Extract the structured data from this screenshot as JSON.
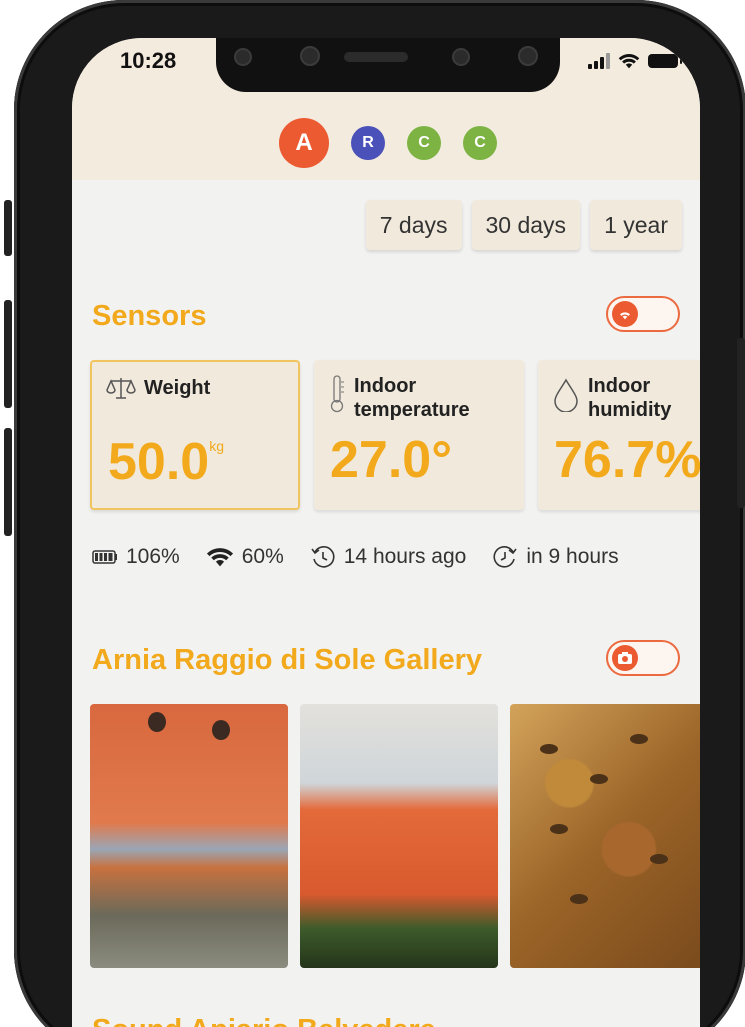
{
  "status_bar": {
    "time": "10:28"
  },
  "header": {
    "avatars": [
      {
        "letter": "A",
        "color": "#ec5a32",
        "selected": true
      },
      {
        "letter": "R",
        "color": "#4a51b8",
        "selected": false
      },
      {
        "letter": "C",
        "color": "#7cb342",
        "selected": false
      },
      {
        "letter": "C",
        "color": "#7cb342",
        "selected": false
      }
    ]
  },
  "range": {
    "days7": "7 days",
    "days30": "30 days",
    "year1": "1 year"
  },
  "sensors": {
    "title": "Sensors",
    "cards": {
      "weight": {
        "label": "Weight",
        "value": "50.0",
        "unit": "kg"
      },
      "temperature": {
        "label_line1": "Indoor",
        "label_line2": "temperature",
        "value": "27.0°"
      },
      "humidity": {
        "label_line1": "Indoor",
        "label_line2": "humidity",
        "value": "76.7%"
      }
    },
    "info": {
      "battery": "106%",
      "signal": "60%",
      "last_update": "14 hours ago",
      "next_update": "in 9 hours"
    }
  },
  "gallery": {
    "title": "Arnia Raggio di Sole Gallery"
  },
  "next_section": {
    "title": "Sound Apiario Belvedere"
  },
  "colors": {
    "accent": "#f2a91c",
    "toggle": "#ec5a32",
    "header_bg": "#f3ebde",
    "card_bg": "#f1e9db"
  }
}
